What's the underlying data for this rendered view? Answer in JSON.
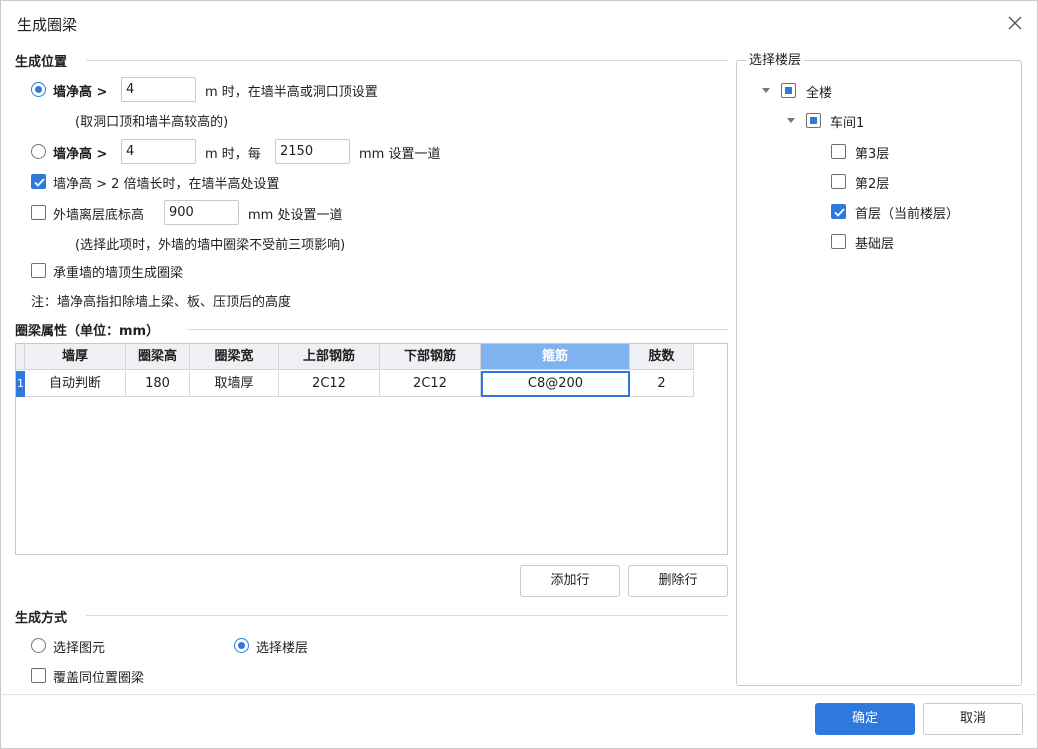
{
  "dialog": {
    "title": "生成圈梁",
    "close_icon": "close-icon"
  },
  "position_section": {
    "title": "生成位置",
    "option1": {
      "label": "墙净高 >",
      "value": "4",
      "suffix": "m 时，在墙半高或洞口顶设置",
      "note": "(取洞口顶和墙半高较高的)",
      "selected": true
    },
    "option2": {
      "label": "墙净高 >",
      "value": "4",
      "middle": "m 时，每",
      "spacing_value": "2150",
      "suffix": "mm 设置一道",
      "selected": false
    },
    "option3": {
      "label": "墙净高 > 2 倍墙长时，在墙半高处设置",
      "checked": true
    },
    "option4": {
      "label": "外墙离层底标高",
      "value": "900",
      "suffix": "mm 处设置一道",
      "note": "(选择此项时，外墙的墙中圈梁不受前三项影响)",
      "checked": false
    },
    "option5": {
      "label": "承重墙的墙顶生成圈梁",
      "checked": false
    },
    "footnote": "注：墙净高指扣除墙上梁、板、压顶后的高度"
  },
  "props_section": {
    "title": "圈梁属性（单位：mm）",
    "columns": [
      "墙厚",
      "圈梁高",
      "圈梁宽",
      "上部钢筋",
      "下部钢筋",
      "箍筋",
      "肢数"
    ],
    "selected_column": 5,
    "rows": [
      {
        "num": "1",
        "cells": [
          "自动判断",
          "180",
          "取墙厚",
          "2C12",
          "2C12",
          "C8@200",
          "2"
        ]
      }
    ],
    "add_row_button": "添加行",
    "delete_row_button": "删除行"
  },
  "method_section": {
    "title": "生成方式",
    "option_select_element": "选择图元",
    "option_select_floor": "选择楼层",
    "selected": "floor",
    "overwrite_label": "覆盖同位置圈梁",
    "overwrite_checked": false
  },
  "floor_panel": {
    "title": "选择楼层",
    "root": {
      "label": "全楼",
      "state": "partial",
      "expanded": true
    },
    "workshop": {
      "label": "车间1",
      "state": "partial",
      "expanded": true
    },
    "floors": [
      {
        "label": "第3层",
        "checked": false
      },
      {
        "label": "第2层",
        "checked": false
      },
      {
        "label": "首层（当前楼层）",
        "checked": true
      },
      {
        "label": "基础层",
        "checked": false
      }
    ]
  },
  "footer": {
    "ok_button": "确定",
    "cancel_button": "取消"
  },
  "colors": {
    "accent": "#2f78de",
    "selected_header": "#7eb3f0"
  }
}
